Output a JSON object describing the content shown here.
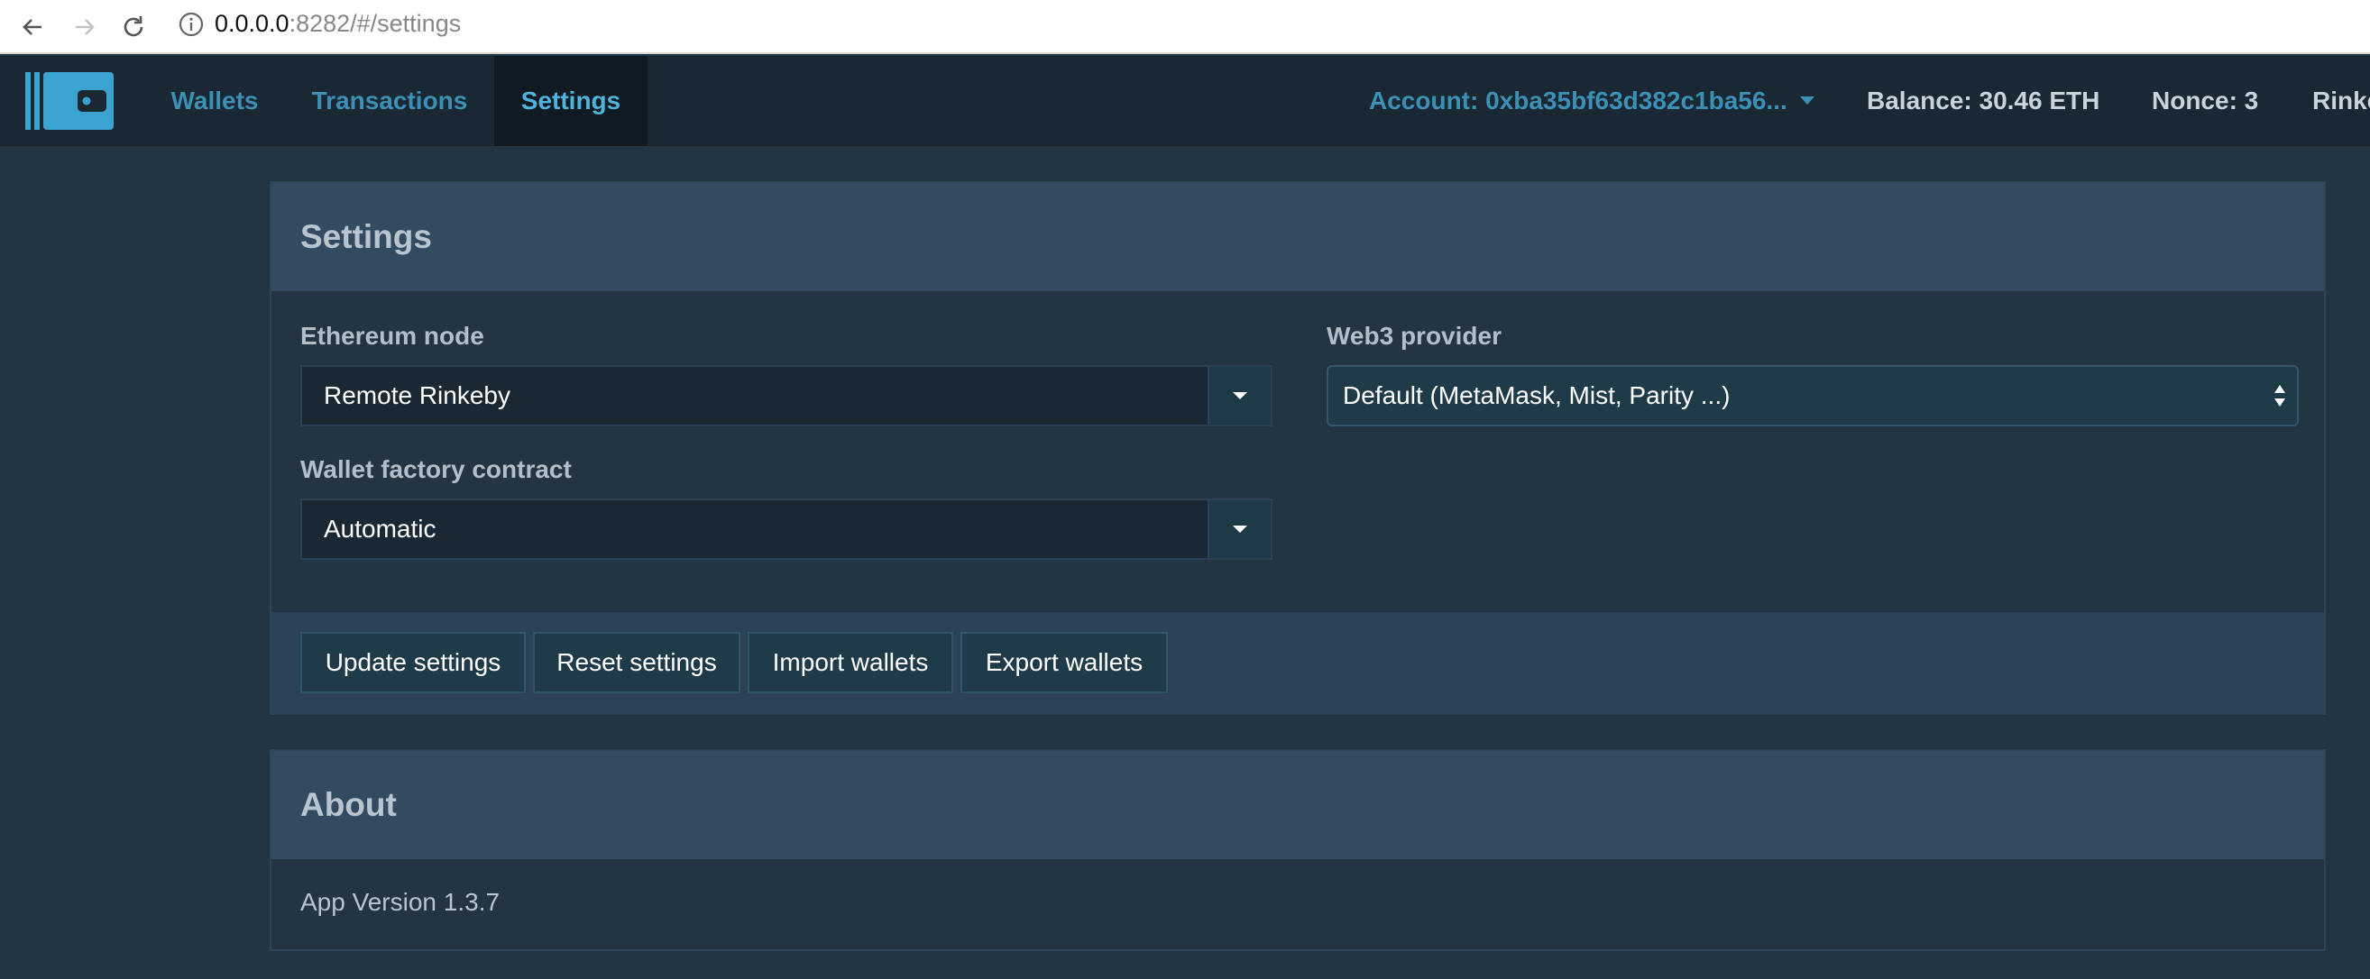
{
  "browser": {
    "url_host": "0.0.0.0",
    "url_path": ":8282/#/settings"
  },
  "header": {
    "nav": [
      {
        "label": "Wallets"
      },
      {
        "label": "Transactions"
      },
      {
        "label": "Settings",
        "active": true
      }
    ],
    "account": "Account: 0xba35bf63d382c1ba56...",
    "balance": "Balance: 30.46 ETH",
    "nonce": "Nonce: 3",
    "network": "Rinke"
  },
  "settings": {
    "title": "Settings",
    "ethereum_node": {
      "label": "Ethereum node",
      "value": "Remote Rinkeby"
    },
    "web3_provider": {
      "label": "Web3 provider",
      "value": "Default (MetaMask, Mist, Parity ...)"
    },
    "wallet_factory": {
      "label": "Wallet factory contract",
      "value": "Automatic"
    },
    "buttons": {
      "update": "Update settings",
      "reset": "Reset settings",
      "import": "Import wallets",
      "export": "Export wallets"
    }
  },
  "about": {
    "title": "About",
    "version": "App Version 1.3.7"
  },
  "colors": {
    "background": "#233442",
    "header": "#1a2833",
    "accent": "#3c8fb5",
    "panel_head": "#324b61"
  }
}
